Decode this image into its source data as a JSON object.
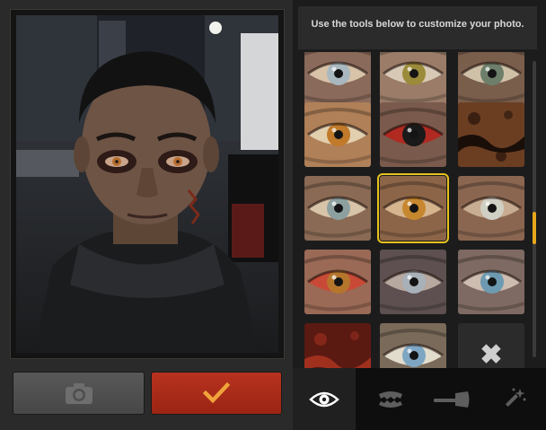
{
  "left_panel": {
    "camera_button": {
      "icon": "camera-icon"
    },
    "confirm_button": {
      "icon": "checkmark-icon",
      "color": "#a62a17"
    }
  },
  "right_panel": {
    "instructions": "Use the tools below to customize your photo.",
    "thumbnails": [
      {
        "kind": "eye",
        "iris": "#a9b7bf",
        "sclera": "#d8c2a8",
        "skin": "#8a6a5a"
      },
      {
        "kind": "eye",
        "iris": "#9b8b3a",
        "sclera": "#d7c9b5",
        "skin": "#9a7c68"
      },
      {
        "kind": "eye",
        "iris": "#6d7f6a",
        "sclera": "#cfc1a8",
        "skin": "#7a5e4c"
      },
      {
        "kind": "eye",
        "iris": "#c07a2a",
        "sclera": "#e2cfae",
        "skin": "#b08058"
      },
      {
        "kind": "eye",
        "iris": "#1a1a1a",
        "sclera": "#b02a22",
        "skin": "#7a5a4c"
      },
      {
        "kind": "texture",
        "base": "#6b3e22",
        "accent": "#1a0e08"
      },
      {
        "kind": "eye",
        "iris": "#8da0a0",
        "sclera": "#d8c4a8",
        "skin": "#8a6a54"
      },
      {
        "kind": "eye",
        "iris": "#c6872e",
        "sclera": "#d6b48e",
        "skin": "#8c6548",
        "selected": true
      },
      {
        "kind": "eye",
        "iris": "#d0cfc4",
        "sclera": "#c9ad92",
        "skin": "#8a6650"
      },
      {
        "kind": "eye",
        "iris": "#b5762c",
        "sclera": "#c84a36",
        "skin": "#9a6a56"
      },
      {
        "kind": "eye",
        "iris": "#a8b0b8",
        "sclera": "#b7a8a0",
        "skin": "#5e5050"
      },
      {
        "kind": "eye",
        "iris": "#6d9ab0",
        "sclera": "#cdbcb0",
        "skin": "#7e6a62"
      },
      {
        "kind": "texture",
        "base": "#5a1a12",
        "accent": "#a0301e"
      },
      {
        "kind": "eye",
        "iris": "#7ea6c2",
        "sclera": "#e2dccc",
        "skin": "#7a6a5a"
      },
      {
        "kind": "remove",
        "icon": "close-icon"
      }
    ],
    "tabs": [
      {
        "name": "eyes",
        "icon": "eye-icon",
        "active": true
      },
      {
        "name": "teeth",
        "icon": "teeth-icon",
        "active": false
      },
      {
        "name": "weapons",
        "icon": "axe-icon",
        "active": false
      },
      {
        "name": "effects",
        "icon": "magic-wand-icon",
        "active": false
      }
    ],
    "scroll": {
      "accent": "#e7a61a"
    },
    "selection_color": "#e7c21c"
  }
}
